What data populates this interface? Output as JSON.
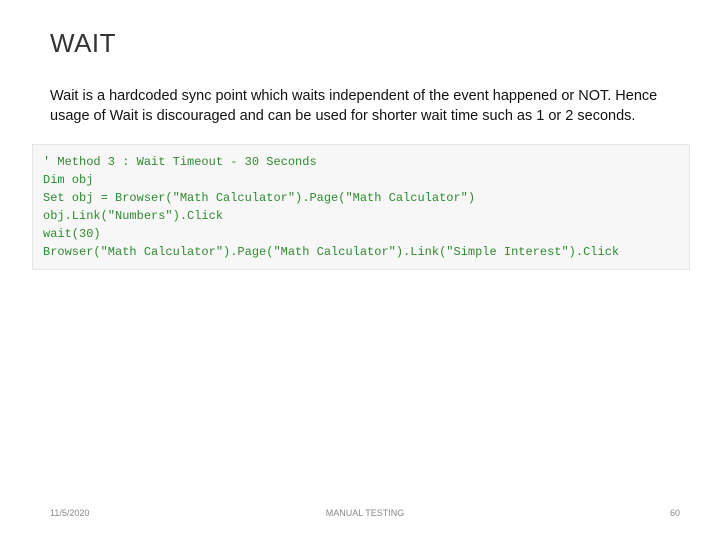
{
  "title": "WAIT",
  "body": "Wait is a hardcoded sync point which waits independent of the event happened or NOT. Hence usage of Wait is discouraged and can be used for shorter wait time such as 1 or 2 seconds.",
  "code": "' Method 3 : Wait Timeout - 30 Seconds\nDim obj\nSet obj = Browser(\"Math Calculator\").Page(\"Math Calculator\")\nobj.Link(\"Numbers\").Click\nwait(30)\nBrowser(\"Math Calculator\").Page(\"Math Calculator\").Link(\"Simple Interest\").Click",
  "footer": {
    "date": "11/5/2020",
    "center": "MANUAL TESTING",
    "page": "60"
  }
}
